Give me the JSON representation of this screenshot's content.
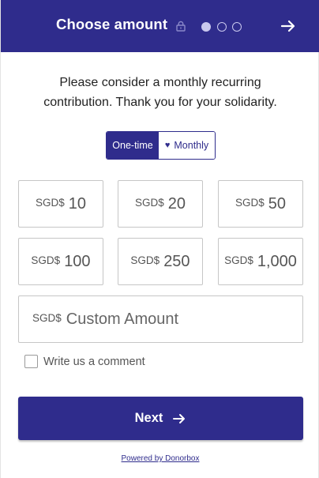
{
  "header": {
    "title": "Choose amount",
    "lock_icon": "lock-icon",
    "steps": 3,
    "current_step": 1,
    "next_icon": "arrow-right-icon",
    "color": "#2f2c8c"
  },
  "intro": {
    "line1": "Please consider a monthly recurring",
    "line2": "contribution. Thank you for your solidarity."
  },
  "frequency": {
    "options": [
      "One-time",
      "Monthly"
    ],
    "selected": "One-time",
    "monthly_icon": "heart-icon"
  },
  "amounts": {
    "currency": "SGD$",
    "options": [
      "10",
      "20",
      "50",
      "100",
      "250",
      "1,000"
    ]
  },
  "custom_amount": {
    "currency": "SGD$",
    "placeholder": "Custom Amount",
    "value": ""
  },
  "comment": {
    "label": "Write us a comment",
    "checked": false
  },
  "next_button": {
    "label": "Next",
    "icon": "arrow-right-icon"
  },
  "footer": {
    "powered_by": "Powered by Donorbox"
  }
}
